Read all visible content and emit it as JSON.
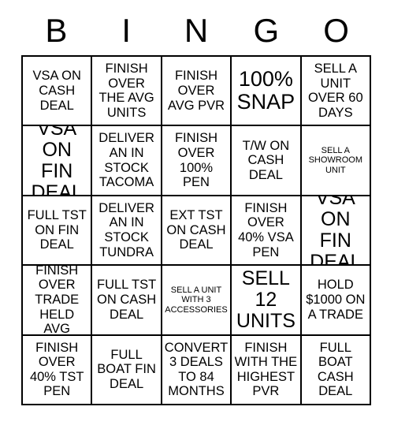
{
  "card": {
    "title_letters": [
      "B",
      "I",
      "N",
      "G",
      "O"
    ],
    "grid_columns": 5,
    "grid_rows": 5,
    "colors": {
      "background": "#ffffff",
      "text": "#000000",
      "border": "#000000"
    },
    "cells": [
      {
        "text": "VSA ON CASH DEAL",
        "size": "normal"
      },
      {
        "text": "FINISH OVER THE AVG UNITS",
        "size": "normal"
      },
      {
        "text": "FINISH OVER AVG PVR",
        "size": "normal"
      },
      {
        "text": "100% SNAP",
        "size": "xlarge"
      },
      {
        "text": "SELL A UNIT OVER 60 DAYS",
        "size": "normal"
      },
      {
        "text": "VSA ON FIN DEAL",
        "size": "large"
      },
      {
        "text": "DELIVER AN IN STOCK TACOMA",
        "size": "normal"
      },
      {
        "text": "FINISH OVER 100% PEN",
        "size": "normal"
      },
      {
        "text": "T/W ON CASH DEAL",
        "size": "normal"
      },
      {
        "text": "SELL A SHOWROOM UNIT",
        "size": "small"
      },
      {
        "text": "FULL TST ON FIN DEAL",
        "size": "normal"
      },
      {
        "text": "DELIVER AN IN STOCK TUNDRA",
        "size": "normal"
      },
      {
        "text": "EXT TST ON CASH DEAL",
        "size": "normal"
      },
      {
        "text": "FINISH OVER 40% VSA PEN",
        "size": "normal"
      },
      {
        "text": "VSA ON FIN DEAL",
        "size": "large"
      },
      {
        "text": "FINISH OVER TRADE HELD AVG",
        "size": "normal"
      },
      {
        "text": "FULL TST ON CASH DEAL",
        "size": "normal"
      },
      {
        "text": "SELL A UNIT WITH 3 ACCESSORIES",
        "size": "small"
      },
      {
        "text": "SELL 12 UNITS",
        "size": "large"
      },
      {
        "text": "HOLD $1000 ON A TRADE",
        "size": "normal"
      },
      {
        "text": "FINISH OVER 40% TST PEN",
        "size": "normal"
      },
      {
        "text": "FULL BOAT FIN DEAL",
        "size": "normal"
      },
      {
        "text": "CONVERT 3 DEALS TO 84 MONTHS",
        "size": "normal"
      },
      {
        "text": "FINISH WITH THE HIGHEST PVR",
        "size": "normal"
      },
      {
        "text": "FULL BOAT CASH DEAL",
        "size": "normal"
      }
    ]
  }
}
